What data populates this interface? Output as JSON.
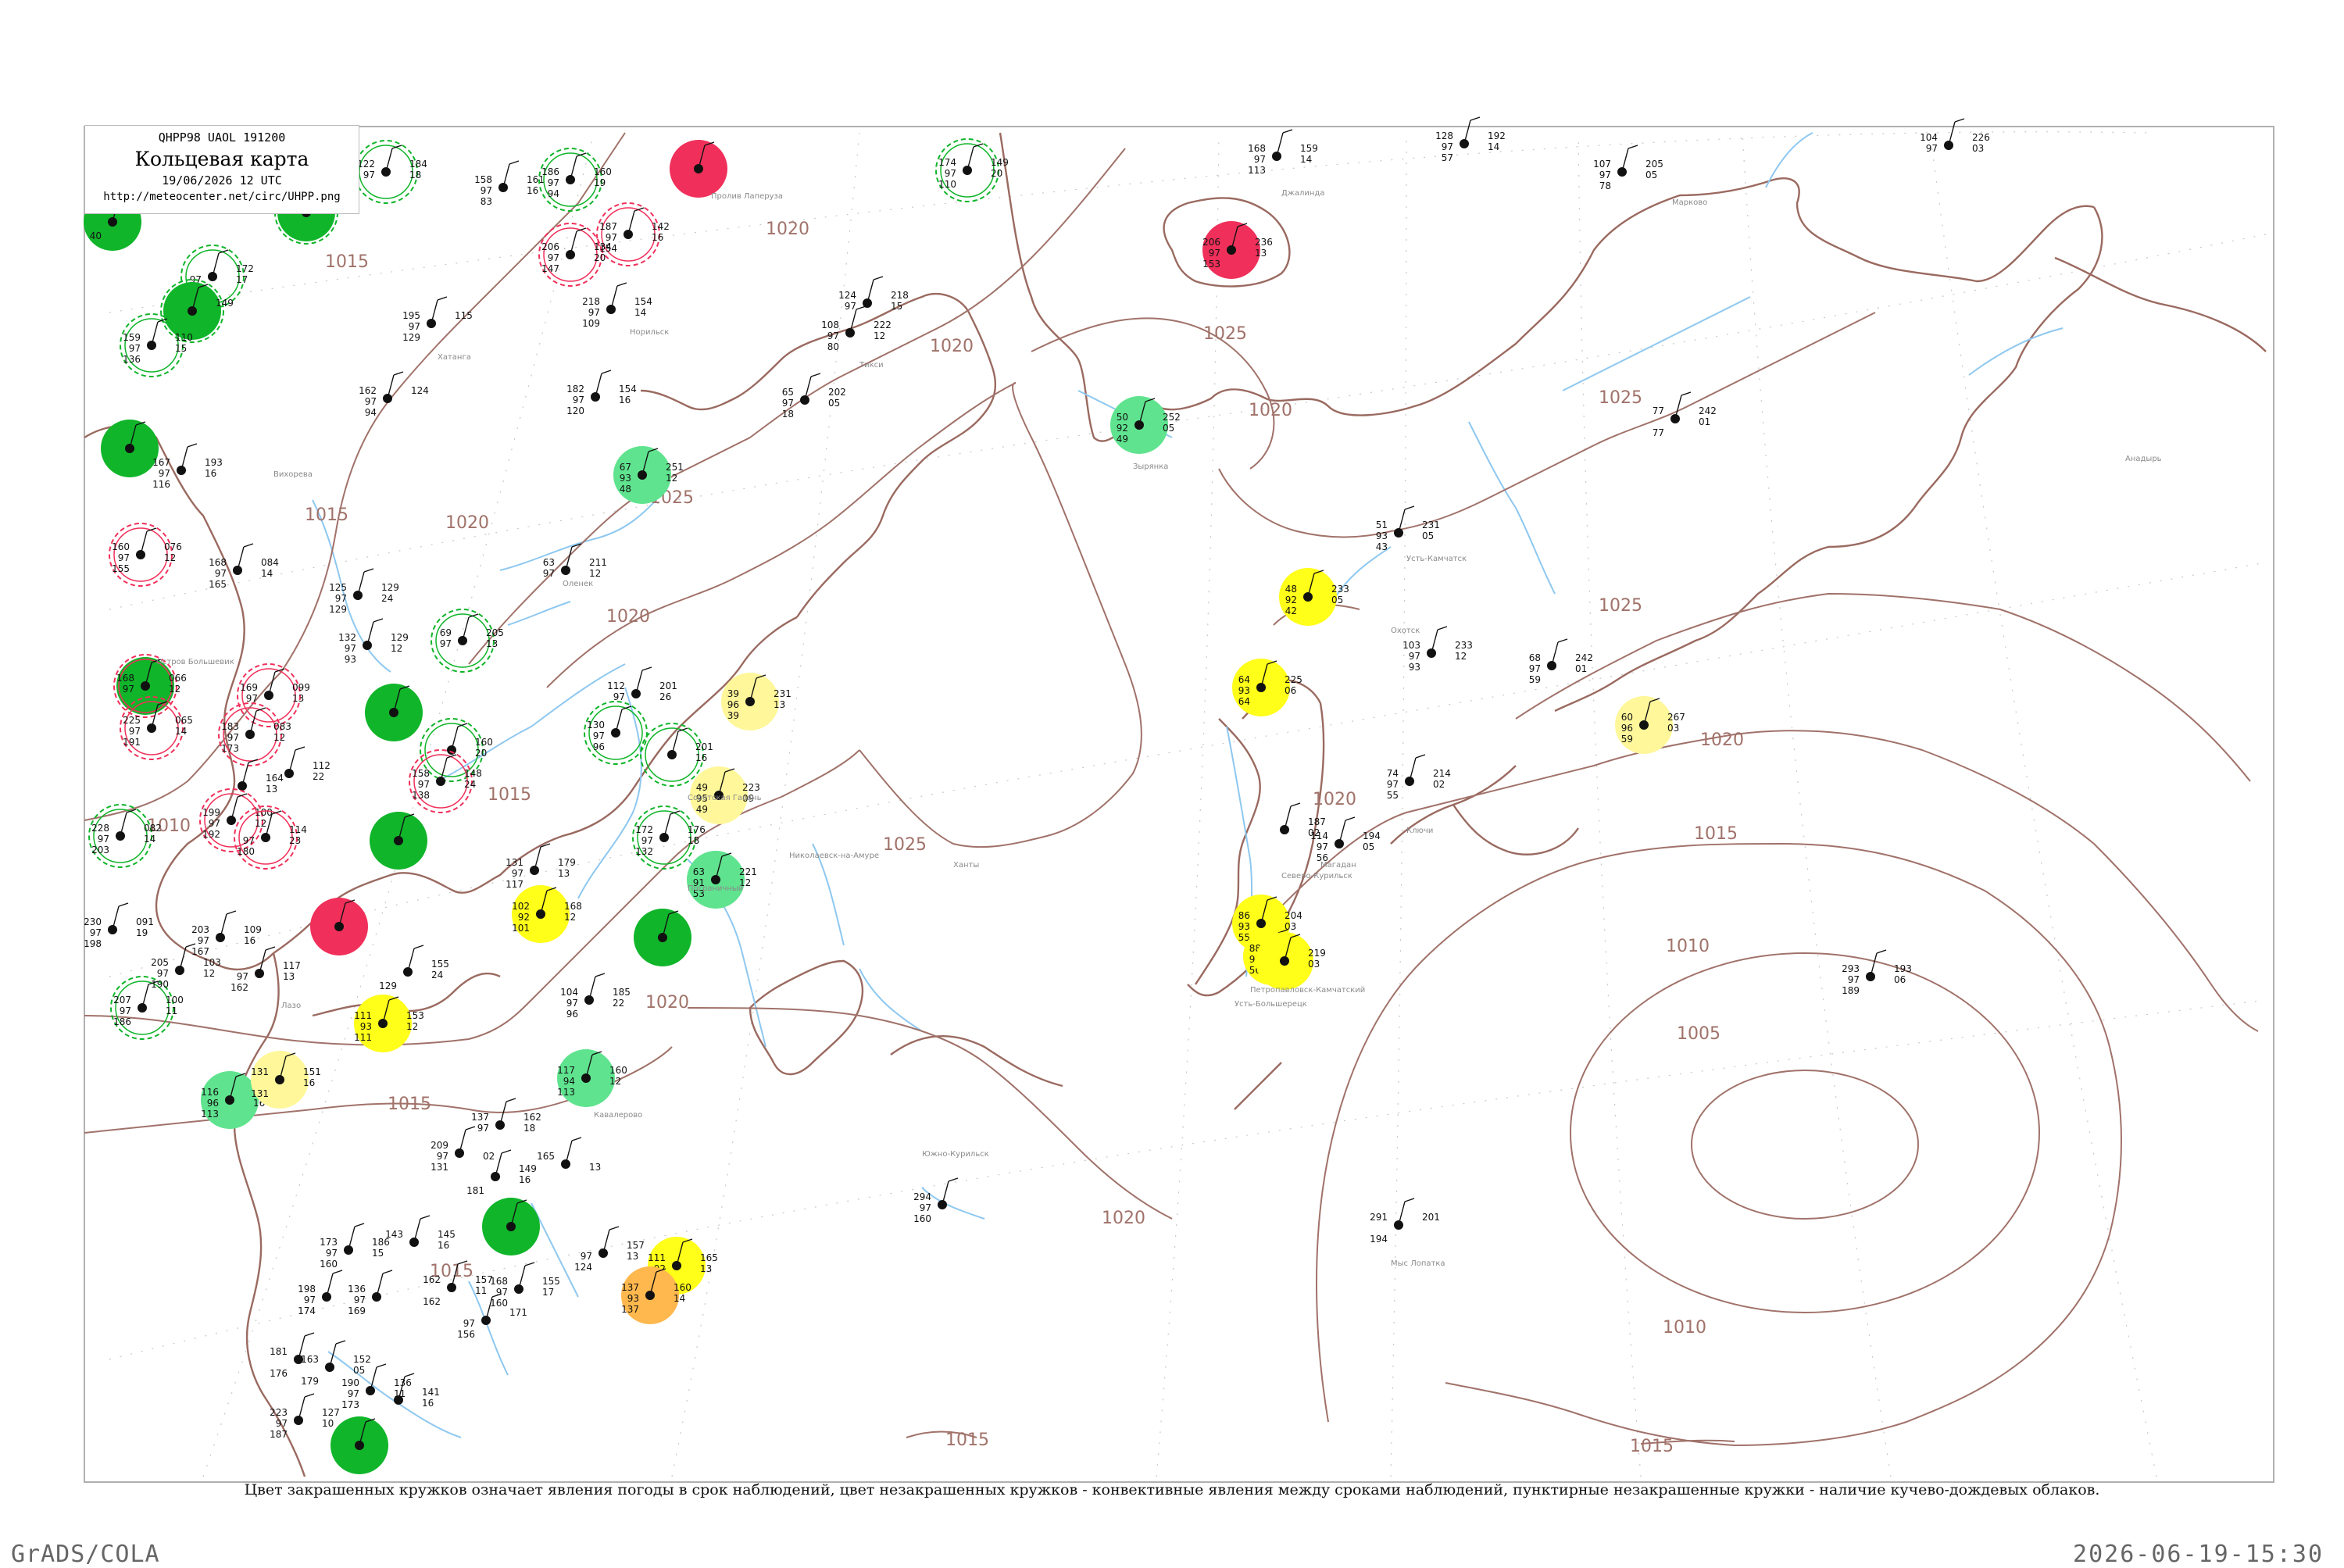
{
  "header": {
    "code": "QHPP98  UAOL  191200",
    "title": "Кольцевая карта",
    "date": "19/06/2026 12 UTC",
    "url": "http://meteocenter.net/circ/UHPP.png"
  },
  "caption": "Цвет закрашенных кружков означает явления погоды в срок наблюдений, цвет незакрашенных кружков - конвективные явления между сроками наблюдений, пунктирные незакрашенные кружки - наличие кучево-дождевых облаков.",
  "footer": {
    "left": "GrADS/COLA",
    "right": "2026-06-19-15:30"
  },
  "colors": {
    "green": "#10b52a",
    "lightgreen": "#5fe38e",
    "yellow": "#ffff1a",
    "paleyellow": "#fff79a",
    "orange": "#ffb84d",
    "red": "#f0305a",
    "coast": "#9a6a60",
    "river": "#8ec8f0",
    "isobar": "#a0726a"
  },
  "isobar_labels": [
    {
      "text": "1020"
    },
    {
      "text": "1020"
    },
    {
      "text": "1025"
    },
    {
      "text": "1015"
    },
    {
      "text": "1015"
    },
    {
      "text": "1020"
    },
    {
      "text": "1025"
    },
    {
      "text": "1020"
    },
    {
      "text": "1015"
    },
    {
      "text": "1010"
    },
    {
      "text": "1020"
    },
    {
      "text": "1025"
    },
    {
      "text": "1025"
    },
    {
      "text": "1020"
    },
    {
      "text": "1025"
    },
    {
      "text": "1020"
    },
    {
      "text": "1015"
    },
    {
      "text": "1010"
    },
    {
      "text": "1005"
    },
    {
      "text": "1010"
    },
    {
      "text": "1020"
    },
    {
      "text": "1015"
    },
    {
      "text": "1015"
    },
    {
      "text": "1020"
    },
    {
      "text": "1015"
    },
    {
      "text": "1015"
    }
  ],
  "stations": [
    {
      "fill": "green",
      "ring": "",
      "v": [
        "",
        "",
        "40",
        "",
        ""
      ]
    },
    {
      "fill": "",
      "ring": "green",
      "v": [
        "122",
        "97",
        "",
        "184",
        "18"
      ]
    },
    {
      "fill": "green",
      "ring": "green",
      "v": [
        "",
        "",
        "",
        "",
        ""
      ]
    },
    {
      "fill": "red",
      "ring": "",
      "v": [
        "",
        "",
        "",
        "",
        ""
      ]
    },
    {
      "fill": "",
      "ring": "green",
      "v": [
        "174",
        "97",
        "110",
        "149",
        "20"
      ]
    },
    {
      "fill": "",
      "ring": "",
      "v": [
        "168",
        "97",
        "113",
        "159",
        "14"
      ]
    },
    {
      "fill": "",
      "ring": "",
      "v": [
        "128",
        "97",
        "57",
        "192",
        "14"
      ]
    },
    {
      "fill": "",
      "ring": "",
      "v": [
        "104",
        "97",
        "",
        "226",
        "03"
      ]
    },
    {
      "fill": "",
      "ring": "",
      "v": [
        "107",
        "97",
        "78",
        "205",
        "05"
      ]
    },
    {
      "fill": "",
      "ring": "",
      "v": [
        "158",
        "97",
        "83",
        "161",
        "16"
      ]
    },
    {
      "fill": "",
      "ring": "green",
      "v": [
        "186",
        "97",
        "94",
        "160",
        "19"
      ]
    },
    {
      "fill": "",
      "ring": "red",
      "v": [
        "187",
        "97",
        "154",
        "142",
        "16"
      ]
    },
    {
      "fill": "",
      "ring": "red",
      "v": [
        "206",
        "97",
        "147",
        "134",
        "20"
      ]
    },
    {
      "fill": "red",
      "ring": "",
      "v": [
        "206",
        "97",
        "153",
        "236",
        "13"
      ]
    },
    {
      "fill": "",
      "ring": "green",
      "v": [
        "",
        "97",
        "",
        "172",
        "17"
      ]
    },
    {
      "fill": "green",
      "ring": "green",
      "v": [
        "",
        "",
        "",
        "149",
        ""
      ]
    },
    {
      "fill": "",
      "ring": "",
      "v": [
        "195",
        "97",
        "129",
        "115",
        ""
      ]
    },
    {
      "fill": "",
      "ring": "",
      "v": [
        "218",
        "97",
        "109",
        "154",
        "14"
      ]
    },
    {
      "fill": "",
      "ring": "",
      "v": [
        "124",
        "97",
        "",
        "218",
        "15"
      ]
    },
    {
      "fill": "",
      "ring": "",
      "v": [
        "108",
        "97",
        "80",
        "222",
        "12"
      ]
    },
    {
      "fill": "",
      "ring": "green",
      "v": [
        "159",
        "97",
        "136",
        "110",
        "15"
      ]
    },
    {
      "fill": "",
      "ring": "",
      "v": [
        "162",
        "97",
        "94",
        "124",
        ""
      ]
    },
    {
      "fill": "",
      "ring": "",
      "v": [
        "182",
        "97",
        "120",
        "154",
        "16"
      ]
    },
    {
      "fill": "",
      "ring": "",
      "v": [
        "65",
        "97",
        "18",
        "202",
        "05"
      ]
    },
    {
      "fill": "lightgreen",
      "ring": "",
      "v": [
        "50",
        "92",
        "49",
        "252",
        "05"
      ]
    },
    {
      "fill": "",
      "ring": "",
      "v": [
        "77",
        "",
        "77",
        "242",
        "01"
      ]
    },
    {
      "fill": "green",
      "ring": "",
      "v": [
        "",
        "",
        "",
        "",
        ""
      ]
    },
    {
      "fill": "",
      "ring": "",
      "v": [
        "167",
        "97",
        "116",
        "193",
        "16"
      ]
    },
    {
      "fill": "lightgreen",
      "ring": "",
      "v": [
        "67",
        "93",
        "48",
        "251",
        "12"
      ]
    },
    {
      "fill": "",
      "ring": "",
      "v": [
        "51",
        "93",
        "43",
        "231",
        "05"
      ]
    },
    {
      "fill": "",
      "ring": "red",
      "v": [
        "160",
        "97",
        "155",
        "076",
        "12"
      ]
    },
    {
      "fill": "",
      "ring": "",
      "v": [
        "168",
        "97",
        "165",
        "084",
        "14"
      ]
    },
    {
      "fill": "",
      "ring": "",
      "v": [
        "63",
        "97",
        "",
        "211",
        "12"
      ]
    },
    {
      "fill": "yellow",
      "ring": "",
      "v": [
        "48",
        "92",
        "42",
        "233",
        "05"
      ]
    },
    {
      "fill": "",
      "ring": "",
      "v": [
        "125",
        "97",
        "129",
        "129",
        "24"
      ]
    },
    {
      "fill": "",
      "ring": "",
      "v": [
        "132",
        "97",
        "93",
        "129",
        "12"
      ]
    },
    {
      "fill": "",
      "ring": "green",
      "v": [
        "69",
        "97",
        "",
        "205",
        "13"
      ]
    },
    {
      "fill": "",
      "ring": "",
      "v": [
        "103",
        "97",
        "93",
        "233",
        "12"
      ]
    },
    {
      "fill": "",
      "ring": "",
      "v": [
        "68",
        "97",
        "59",
        "242",
        "01"
      ]
    },
    {
      "fill": "green",
      "ring": "red",
      "v": [
        "168",
        "97",
        "",
        "066",
        "12"
      ]
    },
    {
      "fill": "",
      "ring": "red",
      "v": [
        "169",
        "97",
        "",
        "099",
        "13"
      ]
    },
    {
      "fill": "green",
      "ring": "",
      "v": [
        "",
        "",
        "",
        "",
        ""
      ]
    },
    {
      "fill": "",
      "ring": "",
      "v": [
        "112",
        "97",
        "",
        "201",
        "26"
      ]
    },
    {
      "fill": "paleyellow",
      "ring": "",
      "v": [
        "39",
        "96",
        "39",
        "231",
        "13"
      ]
    },
    {
      "fill": "yellow",
      "ring": "",
      "v": [
        "64",
        "93",
        "64",
        "225",
        "06"
      ]
    },
    {
      "fill": "paleyellow",
      "ring": "",
      "v": [
        "60",
        "96",
        "59",
        "267",
        "03"
      ]
    },
    {
      "fill": "",
      "ring": "red",
      "v": [
        "225",
        "97",
        "191",
        "065",
        "14"
      ]
    },
    {
      "fill": "",
      "ring": "red",
      "v": [
        "183",
        "97",
        "173",
        "083",
        "12"
      ]
    },
    {
      "fill": "",
      "ring": "green",
      "v": [
        "130",
        "97",
        "96",
        "",
        ""
      ]
    },
    {
      "fill": "",
      "ring": "green",
      "v": [
        "",
        "",
        "",
        "201",
        "16"
      ]
    },
    {
      "fill": "",
      "ring": "green",
      "v": [
        "",
        "",
        "",
        "160",
        "20"
      ]
    },
    {
      "fill": "",
      "ring": "",
      "v": [
        "",
        "",
        "",
        "164",
        "13"
      ]
    },
    {
      "fill": "",
      "ring": "",
      "v": [
        "",
        "",
        "",
        "112",
        "22"
      ]
    },
    {
      "fill": "",
      "ring": "red",
      "v": [
        "158",
        "97",
        "138",
        "148",
        "24"
      ]
    },
    {
      "fill": "paleyellow",
      "ring": "",
      "v": [
        "49",
        "95",
        "49",
        "223",
        "09"
      ]
    },
    {
      "fill": "",
      "ring": "",
      "v": [
        "74",
        "97",
        "55",
        "214",
        "02"
      ]
    },
    {
      "fill": "",
      "ring": "green",
      "v": [
        "228",
        "97",
        "203",
        "082",
        "14"
      ]
    },
    {
      "fill": "",
      "ring": "red",
      "v": [
        "199",
        "97",
        "192",
        "100",
        "12"
      ]
    },
    {
      "fill": "",
      "ring": "red",
      "v": [
        "",
        "97",
        "180",
        "114",
        "23"
      ]
    },
    {
      "fill": "green",
      "ring": "",
      "v": [
        "",
        "",
        "",
        "",
        ""
      ]
    },
    {
      "fill": "",
      "ring": "green",
      "v": [
        "172",
        "97",
        "132",
        "176",
        "18"
      ]
    },
    {
      "fill": "",
      "ring": "",
      "v": [
        "131",
        "97",
        "117",
        "179",
        "13"
      ]
    },
    {
      "fill": "",
      "ring": "",
      "v": [
        "",
        "",
        "",
        "187",
        "02"
      ]
    },
    {
      "fill": "",
      "ring": "",
      "v": [
        "114",
        "97",
        "56",
        "194",
        "05"
      ]
    },
    {
      "fill": "lightgreen",
      "ring": "",
      "v": [
        "63",
        "91",
        "53",
        "221",
        "12"
      ]
    },
    {
      "fill": "red",
      "ring": "",
      "v": [
        "",
        "",
        "",
        "",
        ""
      ]
    },
    {
      "fill": "yellow",
      "ring": "",
      "v": [
        "102",
        "92",
        "101",
        "168",
        "12"
      ]
    },
    {
      "fill": "green",
      "ring": "",
      "v": [
        "",
        "",
        "",
        "",
        ""
      ]
    },
    {
      "fill": "yellow",
      "ring": "",
      "v": [
        "86",
        "93",
        "55",
        "204",
        "03"
      ]
    },
    {
      "fill": "",
      "ring": "",
      "v": [
        "230",
        "97",
        "198",
        "091",
        "19"
      ]
    },
    {
      "fill": "",
      "ring": "",
      "v": [
        "203",
        "97",
        "167",
        "109",
        "16"
      ]
    },
    {
      "fill": "",
      "ring": "",
      "v": [
        "",
        "97",
        "162",
        "117",
        "13"
      ]
    },
    {
      "fill": "",
      "ring": "",
      "v": [
        "",
        "",
        "129",
        "155",
        "24"
      ]
    },
    {
      "fill": "yellow",
      "ring": "",
      "v": [
        "88",
        "97",
        "56",
        "",
        ""
      ]
    },
    {
      "fill": "yellow",
      "ring": "",
      "v": [
        "",
        "",
        "",
        "219",
        "03"
      ]
    },
    {
      "fill": "",
      "ring": "green",
      "v": [
        "207",
        "97",
        "186",
        "100",
        "11"
      ]
    },
    {
      "fill": "",
      "ring": "",
      "v": [
        "205",
        "97",
        "190",
        "103",
        "12"
      ]
    },
    {
      "fill": "",
      "ring": "",
      "v": [
        "104",
        "97",
        "96",
        "185",
        "22"
      ]
    },
    {
      "fill": "yellow",
      "ring": "",
      "v": [
        "111",
        "93",
        "111",
        "153",
        "12"
      ]
    },
    {
      "fill": "lightgreen",
      "ring": "",
      "v": [
        "117",
        "94",
        "113",
        "160",
        "12"
      ]
    },
    {
      "fill": "",
      "ring": "",
      "v": [
        "293",
        "97",
        "189",
        "193",
        "06"
      ]
    },
    {
      "fill": "lightgreen",
      "ring": "",
      "v": [
        "116",
        "96",
        "113",
        "147",
        "16"
      ]
    },
    {
      "fill": "paleyellow",
      "ring": "",
      "v": [
        "131",
        "",
        "131",
        "151",
        "16"
      ]
    },
    {
      "fill": "",
      "ring": "",
      "v": [
        "137",
        "97",
        "",
        "162",
        "18"
      ]
    },
    {
      "fill": "",
      "ring": "",
      "v": [
        "209",
        "97",
        "131",
        "",
        "02"
      ]
    },
    {
      "fill": "",
      "ring": "",
      "v": [
        "165",
        "",
        "",
        "",
        "13"
      ]
    },
    {
      "fill": "",
      "ring": "",
      "v": [
        "",
        "",
        "181",
        "149",
        "16"
      ]
    },
    {
      "fill": "",
      "ring": "",
      "v": [
        "294",
        "97",
        "160",
        "",
        ""
      ]
    },
    {
      "fill": "green",
      "ring": "",
      "v": [
        "",
        "",
        "",
        "",
        ""
      ]
    },
    {
      "fill": "",
      "ring": "",
      "v": [
        "291",
        "",
        "194",
        "201",
        ""
      ]
    },
    {
      "fill": "",
      "ring": "",
      "v": [
        "173",
        "97",
        "160",
        "186",
        "15"
      ]
    },
    {
      "fill": "",
      "ring": "",
      "v": [
        "143",
        "",
        "",
        "145",
        "16"
      ]
    },
    {
      "fill": "",
      "ring": "",
      "v": [
        "",
        "97",
        "124",
        "157",
        "13"
      ]
    },
    {
      "fill": "yellow",
      "ring": "",
      "v": [
        "111",
        "92",
        "",
        "165",
        "13"
      ]
    },
    {
      "fill": "orange",
      "ring": "",
      "v": [
        "137",
        "93",
        "137",
        "160",
        "14"
      ]
    },
    {
      "fill": "",
      "ring": "",
      "v": [
        "198",
        "97",
        "174",
        "",
        ""
      ]
    },
    {
      "fill": "",
      "ring": "",
      "v": [
        "136",
        "97",
        "169",
        "",
        ""
      ]
    },
    {
      "fill": "",
      "ring": "",
      "v": [
        "162",
        "",
        "162",
        "157",
        "11"
      ]
    },
    {
      "fill": "",
      "ring": "",
      "v": [
        "168",
        "97",
        "160",
        "155",
        "17"
      ]
    },
    {
      "fill": "",
      "ring": "",
      "v": [
        "",
        "97",
        "156",
        "171",
        ""
      ]
    },
    {
      "fill": "",
      "ring": "",
      "v": [
        "181",
        "",
        "176",
        "",
        ""
      ]
    },
    {
      "fill": "",
      "ring": "",
      "v": [
        "163",
        "",
        "179",
        "152",
        "05"
      ]
    },
    {
      "fill": "",
      "ring": "",
      "v": [
        "190",
        "97",
        "173",
        "136",
        "11"
      ]
    },
    {
      "fill": "",
      "ring": "",
      "v": [
        "",
        "",
        "",
        "141",
        "16"
      ]
    },
    {
      "fill": "",
      "ring": "",
      "v": [
        "223",
        "97",
        "187",
        "127",
        "10"
      ]
    },
    {
      "fill": "green",
      "ring": "",
      "v": [
        "",
        "",
        "",
        "",
        ""
      ]
    }
  ],
  "station_names": [
    "Вихорева",
    "Пролив Лаперуза",
    "Остров Большевик",
    "Хатанга",
    "Норильск",
    "Тикси",
    "Зырянка",
    "Анадырь",
    "Оленек",
    "Джалинда",
    "Марково",
    "Усть-Камчатск",
    "Усть-Большерецк",
    "Советская Гавань",
    "Николаевск-на-Амуре",
    "Охотск",
    "Петропавловск-Камчатский",
    "Северо-Курильск",
    "Ключи",
    "Кавалерово",
    "Пограничный",
    "Магадан",
    "Лазо",
    "Ханты",
    "Южно-Курильск",
    "Мыс Лопатка"
  ]
}
